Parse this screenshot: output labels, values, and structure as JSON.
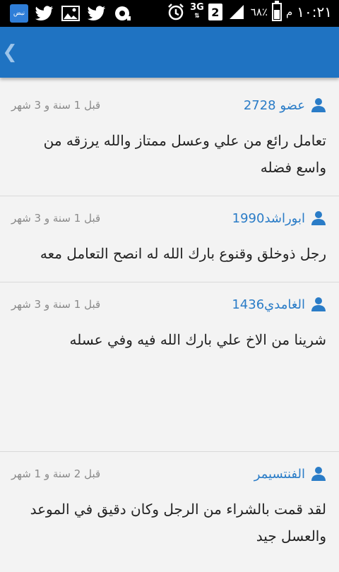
{
  "status_bar": {
    "app_icon_label": "نبض",
    "battery_percent": "٦٨٪",
    "carrier_letter": "م",
    "time": "١٠:٢١",
    "network": "3G",
    "sim_slot": "2",
    "battery_level": 0.68
  },
  "app_bar": {
    "back_glyph": "❮"
  },
  "reviews": [
    {
      "author": "عضو 2728",
      "date": "قبل 1 سنة و 3 شهر",
      "text": "تعامل رائع من علي وعسل ممتاز والله يرزقه من واسع فضله"
    },
    {
      "author": "ابوراشد1990",
      "date": "قبل 1 سنة و 3 شهر",
      "text": "رجل ذوخلق وقنوع بارك الله له انصح التعامل معه"
    },
    {
      "author": "الغامدي1436",
      "date": "قبل 1 سنة و 3 شهر",
      "text": "شرينا من الاخ علي بارك الله فيه وفي عسله"
    },
    {
      "author": "الفنتسيمر",
      "date": "قبل 2 سنة و 1 شهر",
      "text": "لقد قمت بالشراء من الرجل وكان دقيق في الموعد والعسل جيد"
    }
  ]
}
